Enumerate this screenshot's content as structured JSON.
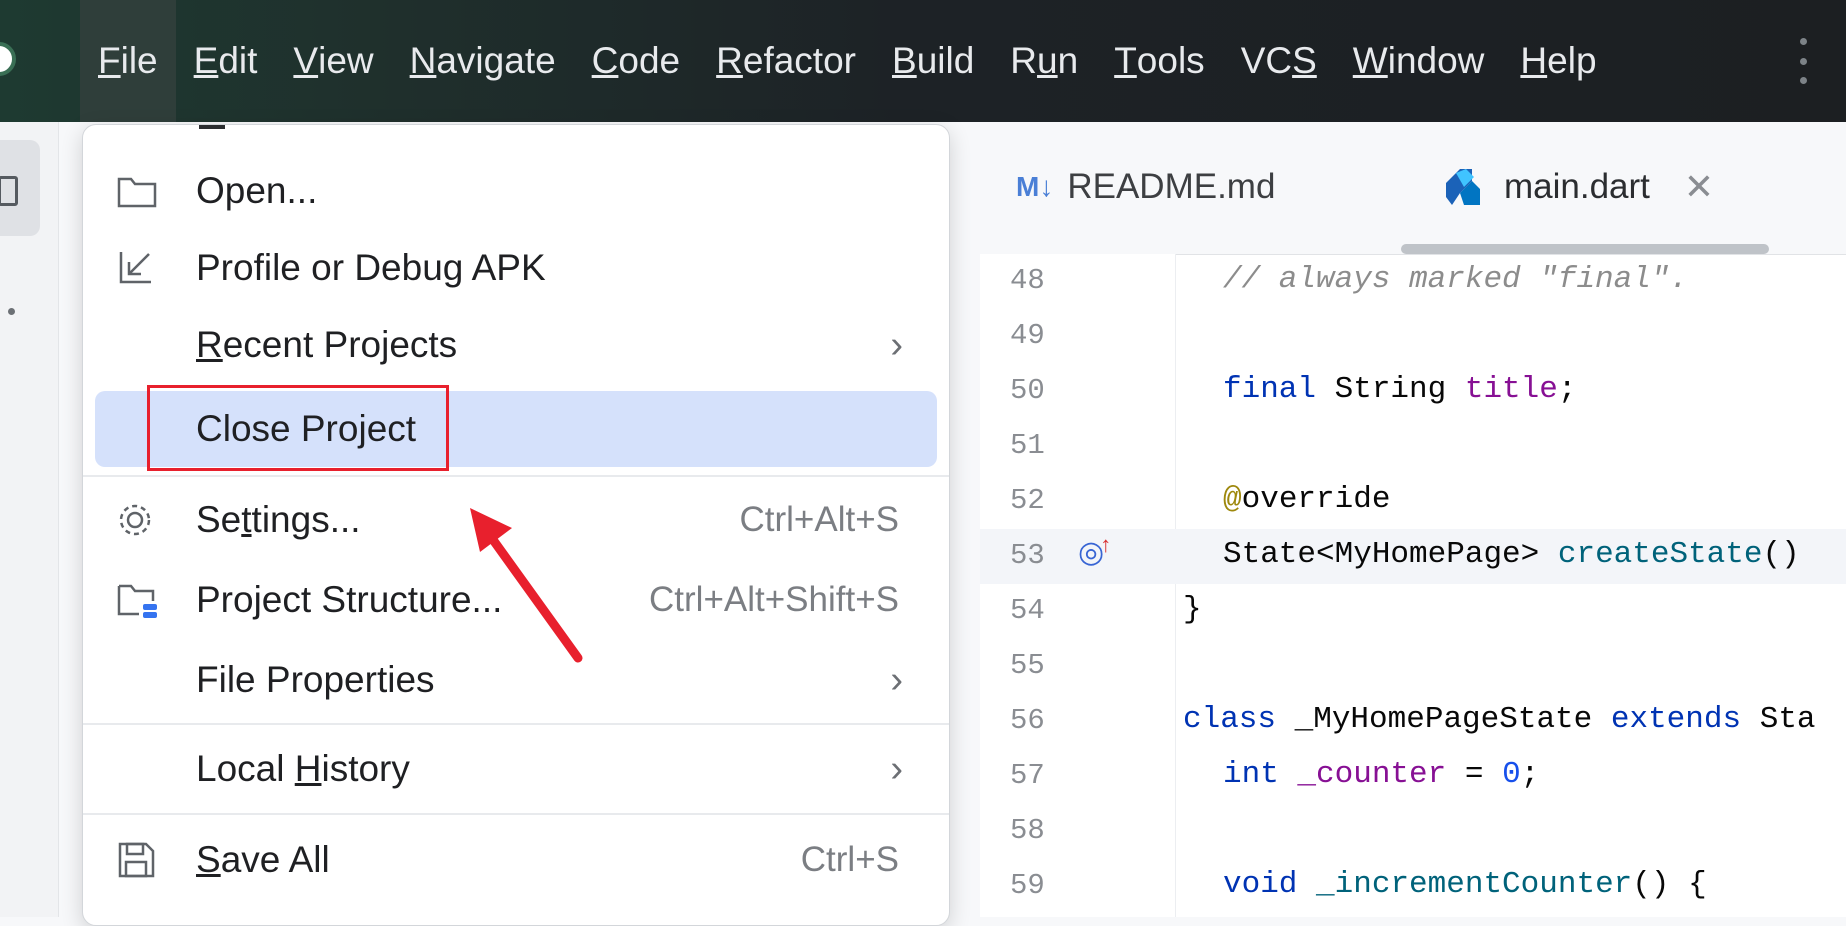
{
  "menubar": {
    "items": [
      "File",
      "Edit",
      "View",
      "Navigate",
      "Code",
      "Refactor",
      "Build",
      "Run",
      "Tools",
      "VCS",
      "Window",
      "Help"
    ],
    "active": "File"
  },
  "tabs": [
    {
      "label": "README.md",
      "icon": "markdown-icon",
      "badge": "M↓"
    },
    {
      "label": "main.dart",
      "icon": "dart-icon",
      "close": "✕"
    }
  ],
  "code_lines": [
    {
      "num": "48",
      "text": "// always marked \"final\"."
    },
    {
      "num": "49",
      "text": ""
    },
    {
      "num": "50",
      "text": "final String title;"
    },
    {
      "num": "51",
      "text": ""
    },
    {
      "num": "52",
      "text": "@override"
    },
    {
      "num": "53",
      "text": "State<MyHomePage> createState()"
    },
    {
      "num": "54",
      "text": "}"
    },
    {
      "num": "55",
      "text": ""
    },
    {
      "num": "56",
      "text": "class _MyHomePageState extends Sta"
    },
    {
      "num": "57",
      "text": "int _counter = 0;"
    },
    {
      "num": "58",
      "text": ""
    },
    {
      "num": "59",
      "text": "void _incrementCounter() {"
    }
  ],
  "file_menu": {
    "items": [
      {
        "label": "Open...",
        "icon": "folder-icon",
        "shortcut": ""
      },
      {
        "label": "Profile or Debug APK",
        "icon": "import-arrow-icon",
        "shortcut": ""
      },
      {
        "label": "Recent Projects",
        "submenu": true
      },
      {
        "label": "Close Project",
        "selected": true
      },
      {
        "label": "Settings...",
        "icon": "gear-icon",
        "shortcut": "Ctrl+Alt+S"
      },
      {
        "label": "Project Structure...",
        "icon": "project-structure-icon",
        "shortcut": "Ctrl+Alt+Shift+S"
      },
      {
        "label": "File Properties",
        "submenu": true
      },
      {
        "label": "Local History",
        "submenu": true
      },
      {
        "label": "Save All",
        "icon": "save-icon",
        "shortcut": "Ctrl+S"
      }
    ]
  },
  "colors": {
    "selection": "#d5e1fb",
    "annotation_red": "#e8202d",
    "keyword": "#0033b3",
    "field": "#871094"
  }
}
